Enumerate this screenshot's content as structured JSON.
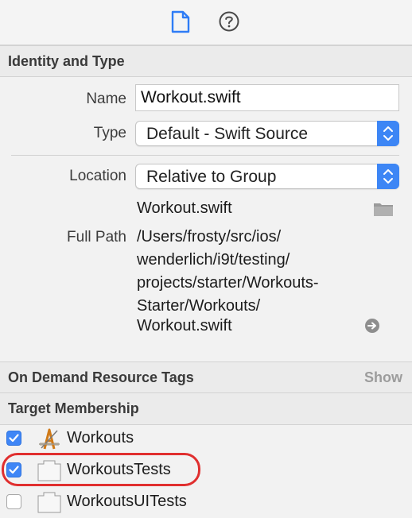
{
  "toolbar": {
    "file_inspector_icon": "document-icon",
    "quick_help_icon": "question-circle-icon",
    "accent_color": "#2e7cf6"
  },
  "identity": {
    "header": "Identity and Type",
    "name_label": "Name",
    "name_value": "Workout.swift",
    "type_label": "Type",
    "type_value": "Default - Swift Source",
    "location_label": "Location",
    "location_value": "Relative to Group",
    "file_name": "Workout.swift",
    "full_path_label": "Full Path",
    "full_path_lines": [
      "/Users/frosty/src/ios/",
      "wenderlich/i9t/testing/",
      "projects/starter/Workouts-",
      "Starter/Workouts/",
      "Workout.swift"
    ]
  },
  "on_demand": {
    "header": "On Demand Resource Tags",
    "show_label": "Show"
  },
  "target_membership": {
    "header": "Target Membership",
    "targets": [
      {
        "label": "Workouts",
        "checked": true,
        "icon": "app-target-icon"
      },
      {
        "label": "WorkoutsTests",
        "checked": true,
        "icon": "test-bundle-icon",
        "highlighted": true
      },
      {
        "label": "WorkoutsUITests",
        "checked": false,
        "icon": "test-bundle-icon"
      }
    ],
    "highlight_color": "#e02f2f",
    "checkbox_color": "#3f86f6"
  }
}
